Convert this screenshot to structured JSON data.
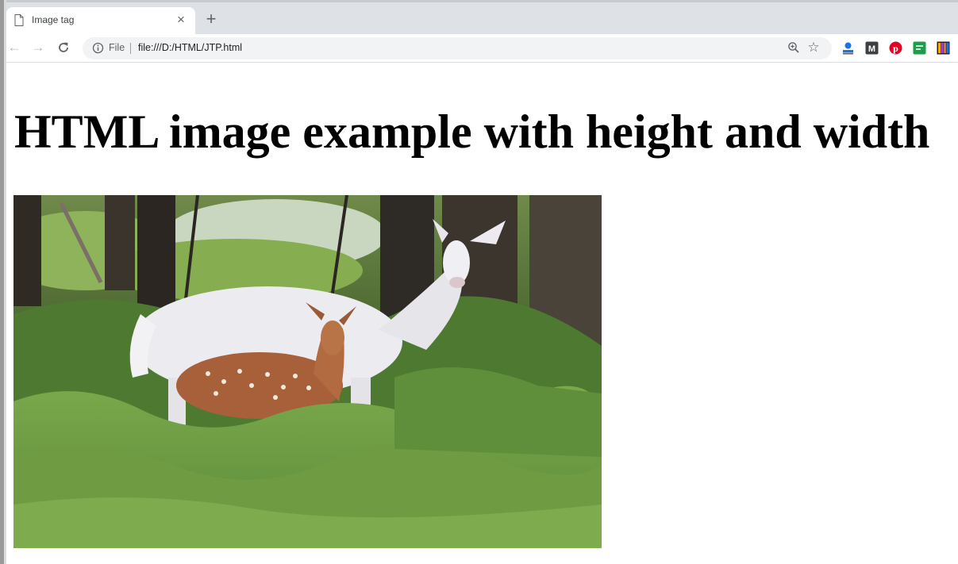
{
  "browser": {
    "tab": {
      "title": "Image tag",
      "close_icon": "close-icon"
    },
    "new_tab_icon": "plus-icon",
    "toolbar": {
      "back_icon": "back-arrow-icon",
      "forward_icon": "forward-arrow-icon",
      "reload_icon": "reload-icon",
      "site_info_icon": "info-icon",
      "scheme_label": "File",
      "url": "file:///D:/HTML/JTP.html",
      "zoom_icon": "zoom-icon",
      "bookmark_icon": "star-icon",
      "extensions": [
        "person-extension-icon",
        "m-extension-icon",
        "pinterest-extension-icon",
        "green-extension-icon",
        "colorful-extension-icon"
      ]
    }
  },
  "page": {
    "heading": "HTML image example with height and width",
    "image": {
      "subject": "white deer and spotted fawn among ferns in a forest"
    }
  },
  "colors": {
    "tabstrip": "#dee1e6",
    "omnibox": "#f1f3f4",
    "pinterest": "#e60023",
    "person_ext": "#1a73e8"
  }
}
